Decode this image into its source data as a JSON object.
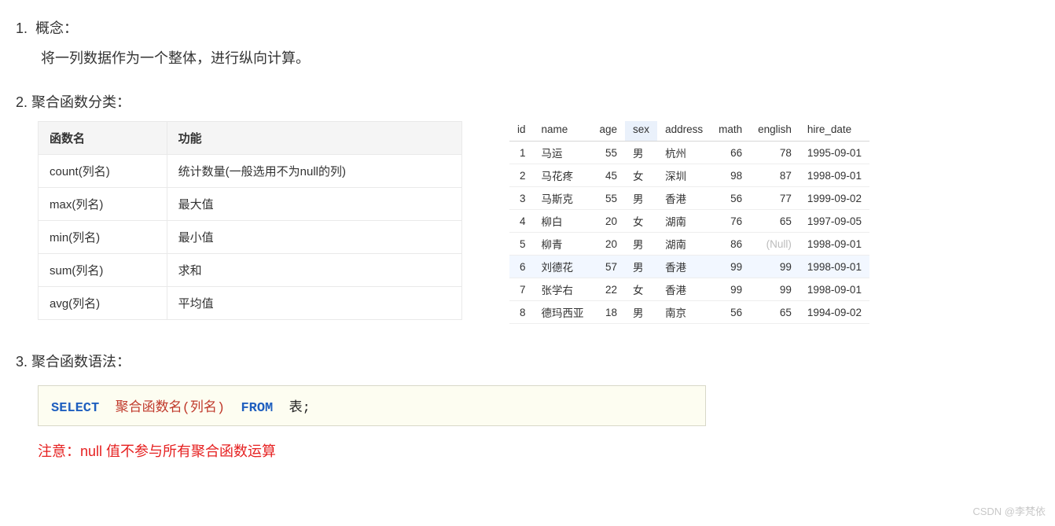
{
  "section1": {
    "num": "1.",
    "heading": "概念：",
    "body": "将一列数据作为一个整体，进行纵向计算。"
  },
  "section2": {
    "num": "2.",
    "heading": "聚合函数分类："
  },
  "fn_table": {
    "headers": {
      "name": "函数名",
      "desc": "功能"
    },
    "rows": [
      {
        "name": "count(列名)",
        "desc": "统计数量(一般选用不为null的列)"
      },
      {
        "name": "max(列名)",
        "desc": "最大值"
      },
      {
        "name": "min(列名)",
        "desc": "最小值"
      },
      {
        "name": "sum(列名)",
        "desc": "求和"
      },
      {
        "name": "avg(列名)",
        "desc": "平均值"
      }
    ]
  },
  "data_table": {
    "headers": {
      "id": "id",
      "name": "name",
      "age": "age",
      "sex": "sex",
      "address": "address",
      "math": "math",
      "english": "english",
      "hire_date": "hire_date"
    },
    "rows": [
      {
        "id": "1",
        "name": "马运",
        "age": "55",
        "sex": "男",
        "address": "杭州",
        "math": "66",
        "english": "78",
        "hire_date": "1995-09-01"
      },
      {
        "id": "2",
        "name": "马花疼",
        "age": "45",
        "sex": "女",
        "address": "深圳",
        "math": "98",
        "english": "87",
        "hire_date": "1998-09-01"
      },
      {
        "id": "3",
        "name": "马斯克",
        "age": "55",
        "sex": "男",
        "address": "香港",
        "math": "56",
        "english": "77",
        "hire_date": "1999-09-02"
      },
      {
        "id": "4",
        "name": "柳白",
        "age": "20",
        "sex": "女",
        "address": "湖南",
        "math": "76",
        "english": "65",
        "hire_date": "1997-09-05"
      },
      {
        "id": "5",
        "name": "柳青",
        "age": "20",
        "sex": "男",
        "address": "湖南",
        "math": "86",
        "english": "(Null)",
        "hire_date": "1998-09-01"
      },
      {
        "id": "6",
        "name": "刘德花",
        "age": "57",
        "sex": "男",
        "address": "香港",
        "math": "99",
        "english": "99",
        "hire_date": "1998-09-01"
      },
      {
        "id": "7",
        "name": "张学右",
        "age": "22",
        "sex": "女",
        "address": "香港",
        "math": "99",
        "english": "99",
        "hire_date": "1998-09-01"
      },
      {
        "id": "8",
        "name": "德玛西亚",
        "age": "18",
        "sex": "男",
        "address": "南京",
        "math": "56",
        "english": "65",
        "hire_date": "1994-09-02"
      }
    ]
  },
  "section3": {
    "num": "3.",
    "heading": "聚合函数语法："
  },
  "code": {
    "select": "SELECT",
    "fn": "聚合函数名",
    "lp": "(",
    "col": "列名",
    "rp": ")",
    "from": "FROM",
    "tbl": "表",
    "semi": ";"
  },
  "note": "注意：null 值不参与所有聚合函数运算",
  "watermark": "CSDN @李梵依",
  "chart_data": {
    "type": "table",
    "title": "聚合函数分类与示例数据",
    "function_table": {
      "columns": [
        "函数名",
        "功能"
      ],
      "rows": [
        [
          "count(列名)",
          "统计数量(一般选用不为null的列)"
        ],
        [
          "max(列名)",
          "最大值"
        ],
        [
          "min(列名)",
          "最小值"
        ],
        [
          "sum(列名)",
          "求和"
        ],
        [
          "avg(列名)",
          "平均值"
        ]
      ]
    },
    "student_table": {
      "columns": [
        "id",
        "name",
        "age",
        "sex",
        "address",
        "math",
        "english",
        "hire_date"
      ],
      "rows": [
        [
          1,
          "马运",
          55,
          "男",
          "杭州",
          66,
          78,
          "1995-09-01"
        ],
        [
          2,
          "马花疼",
          45,
          "女",
          "深圳",
          98,
          87,
          "1998-09-01"
        ],
        [
          3,
          "马斯克",
          55,
          "男",
          "香港",
          56,
          77,
          "1999-09-02"
        ],
        [
          4,
          "柳白",
          20,
          "女",
          "湖南",
          76,
          65,
          "1997-09-05"
        ],
        [
          5,
          "柳青",
          20,
          "男",
          "湖南",
          86,
          null,
          "1998-09-01"
        ],
        [
          6,
          "刘德花",
          57,
          "男",
          "香港",
          99,
          99,
          "1998-09-01"
        ],
        [
          7,
          "张学右",
          22,
          "女",
          "香港",
          99,
          99,
          "1998-09-01"
        ],
        [
          8,
          "德玛西亚",
          18,
          "男",
          "南京",
          56,
          65,
          "1994-09-02"
        ]
      ]
    }
  }
}
